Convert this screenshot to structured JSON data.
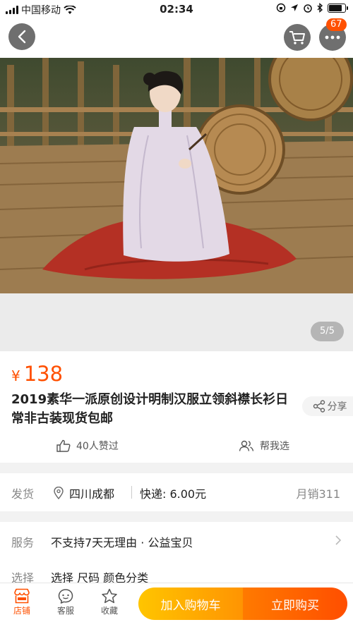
{
  "status_bar": {
    "carrier": "中国移动",
    "time": "02:34",
    "battery_level": 0.9
  },
  "nav": {
    "back_icon": "chevron-left-icon",
    "cart_icon": "cart-icon",
    "more_icon": "more-dots-icon",
    "message_count": "67"
  },
  "gallery": {
    "page_indicator": "5/5"
  },
  "product": {
    "currency": "¥",
    "price": "138",
    "title": "2019素华一派原创设计明制汉服立领斜襟长衫日常非古装现货包邮",
    "share_label": "分享",
    "likes_label": "40人赞过",
    "help_label": "帮我选"
  },
  "shipping": {
    "label": "发货",
    "location": "四川成都",
    "fee": "快递: 6.00元",
    "monthly_sales": "月销311"
  },
  "service": {
    "label": "服务",
    "value": "不支持7天无理由 · 公益宝贝"
  },
  "select": {
    "label": "选择",
    "value": "选择 尺码 颜色分类"
  },
  "bottom_bar": {
    "store_label": "店铺",
    "service_label": "客服",
    "favorite_label": "收藏",
    "add_cart_label": "加入购物车",
    "buy_now_label": "立即购买"
  },
  "colors": {
    "accent": "#ff5000",
    "add_cart_start": "#ffc500",
    "add_cart_end": "#ff9402",
    "buy_now_start": "#ff7a00",
    "buy_now_end": "#ff4e00"
  }
}
